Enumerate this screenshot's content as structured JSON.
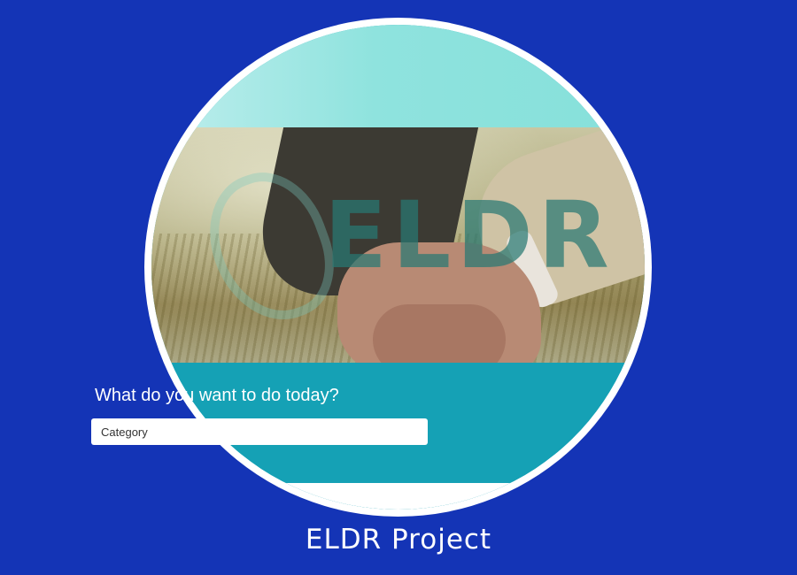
{
  "app": {
    "logo_text": "ELDR",
    "question": "What do you want to do today?",
    "category_placeholder": "Category"
  },
  "caption": "ELDR Project",
  "colors": {
    "background": "#1434b6",
    "panel": "#15a1b5",
    "top_band": "#8fe3de",
    "frame": "#ffffff"
  },
  "icons": [
    "eldr-logo-emblem"
  ]
}
